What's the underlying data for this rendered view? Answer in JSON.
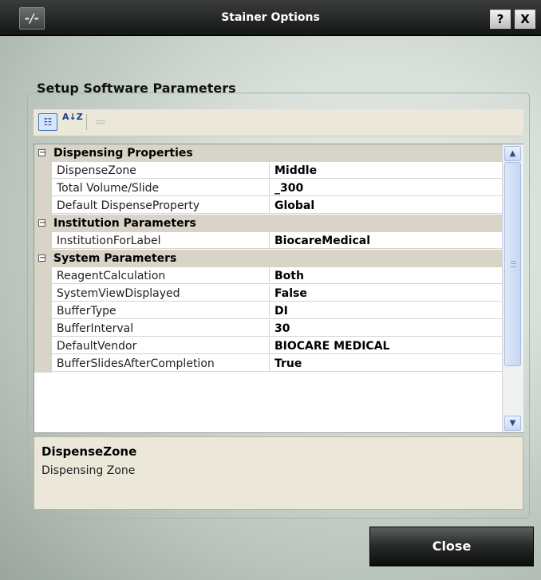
{
  "window": {
    "title": "Stainer Options",
    "logo_text": "-/-",
    "help_label": "?",
    "close_label": "X"
  },
  "group": {
    "title": "Setup Software Parameters"
  },
  "toolbar": {
    "categorized_icon": "categorized-view-icon",
    "alphabetical_label": "A↓Z",
    "property_pages_icon": "property-pages-icon"
  },
  "grid": {
    "categories": [
      {
        "label": "Dispensing Properties",
        "toggle": "−",
        "properties": [
          {
            "name": "DispenseZone",
            "value": "Middle"
          },
          {
            "name": "Total Volume/Slide",
            "value": "_300"
          },
          {
            "name": "Default DispenseProperty",
            "value": "Global"
          }
        ]
      },
      {
        "label": "Institution Parameters",
        "toggle": "−",
        "properties": [
          {
            "name": "InstitutionForLabel",
            "value": "BiocareMedical"
          }
        ]
      },
      {
        "label": "System Parameters",
        "toggle": "−",
        "properties": [
          {
            "name": "ReagentCalculation",
            "value": "Both"
          },
          {
            "name": "SystemViewDisplayed",
            "value": "False"
          },
          {
            "name": "BufferType",
            "value": "DI"
          },
          {
            "name": "BufferInterval",
            "value": "30"
          },
          {
            "name": "DefaultVendor",
            "value": "BIOCARE MEDICAL"
          },
          {
            "name": "BufferSlidesAfterCompletion",
            "value": "True"
          }
        ]
      }
    ],
    "scroll_up": "▲",
    "scroll_down": "▼"
  },
  "help_panel": {
    "title": "DispenseZone",
    "description": "Dispensing Zone"
  },
  "footer": {
    "close_button": "Close"
  }
}
